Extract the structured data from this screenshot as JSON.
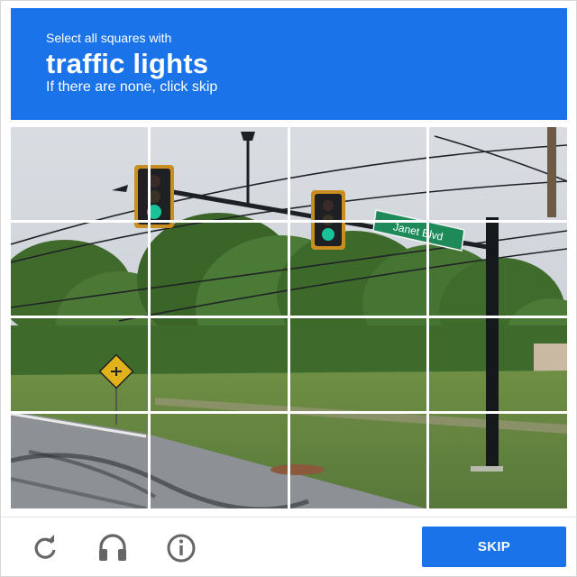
{
  "header": {
    "instruction": "Select all squares with",
    "target": "traffic lights",
    "hint": "If there are none, click skip"
  },
  "grid": {
    "rows": 4,
    "cols": 4
  },
  "scene": {
    "street_sign": "Janet Blvd"
  },
  "footer": {
    "reload_icon": "reload-icon",
    "audio_icon": "headphones-icon",
    "info_icon": "info-icon",
    "skip_label": "SKIP"
  },
  "colors": {
    "accent": "#1a73e8",
    "street_sign": "#1e8a5a"
  }
}
